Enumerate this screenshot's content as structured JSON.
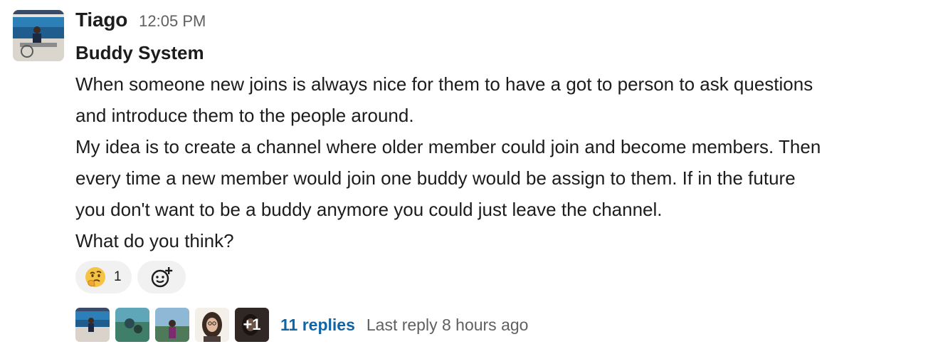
{
  "message": {
    "author": "Tiago",
    "time": "12:05 PM",
    "title": "Buddy System",
    "body_lines": [
      "When someone new joins is always nice for them to have a got to person to ask questions",
      "and introduce them to the people around.",
      "My idea is to create a channel where older member could join and become members. Then",
      "every time a new member would join one buddy would be assign to them. If in the future",
      "you don't want to be a buddy anymore you could just leave the channel.",
      "What do you think?"
    ]
  },
  "reactions": [
    {
      "emoji": "thinking-face",
      "count": "1"
    }
  ],
  "add_reaction_icon": "add-emoji-icon",
  "thread": {
    "more_label": "+1",
    "replies_label": "11 replies",
    "last_reply": "Last reply 8 hours ago"
  },
  "colors": {
    "link": "#1264a3",
    "muted": "#616061",
    "pill": "#f1f1f1"
  }
}
